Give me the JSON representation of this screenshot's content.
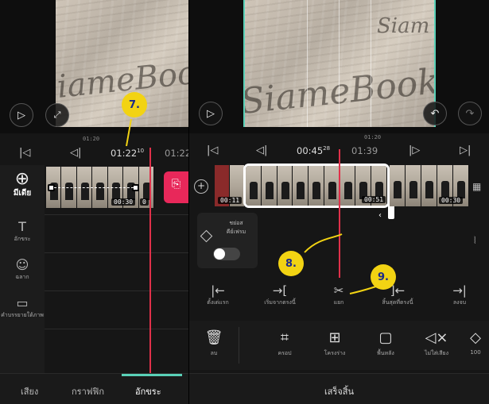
{
  "left_panel": {
    "ruler": {
      "label": "01:20"
    },
    "transport": {
      "time_main": "01:22",
      "time_sup": "10",
      "time_next": "01:22"
    },
    "sidebar": [
      {
        "icon": "plus-circle-icon",
        "label": "มีเดีย"
      },
      {
        "icon": "text-icon",
        "label": "อักขระ"
      },
      {
        "icon": "sticker-icon",
        "label": "ฉลาก"
      },
      {
        "icon": "subtitle-icon",
        "label": "คำบรรยายใต้ภาพ"
      }
    ],
    "clip": {
      "duration": "00:30",
      "count": "0"
    },
    "bottom_nav": {
      "tab_audio": "เสียง",
      "tab_graphic": "กราฟฟิก",
      "tab_text": "อักขระ"
    }
  },
  "right_panel": {
    "ruler": {
      "label": "01:20"
    },
    "transport": {
      "time_main": "00:45",
      "time_sup": "28",
      "time_next": "01:39"
    },
    "clip_durations": {
      "start": "00:11",
      "selected": "00:51",
      "end": "00:30"
    },
    "keyframe_panel": {
      "title": "ชย่อส\nคีย์เฟรม"
    },
    "toolbar_top": [
      {
        "icon": "trim-left-icon",
        "label": "ตั้งเด่แรก"
      },
      {
        "icon": "split-left-icon",
        "label": "เริ่มจากตรงนี้"
      },
      {
        "icon": "scissors-icon",
        "label": "แยก"
      },
      {
        "icon": "split-right-icon",
        "label": "สิ้นสุดที่ตรงนี้"
      },
      {
        "icon": "trim-right-icon",
        "label": "ลงจบ"
      }
    ],
    "toolbar_bottom": [
      {
        "icon": "trash-icon",
        "label": "ลบ"
      },
      {
        "icon": "crop-icon",
        "label": "ครอป"
      },
      {
        "icon": "layout-icon",
        "label": "โครงร่าง"
      },
      {
        "icon": "background-icon",
        "label": "พื้นหลัง"
      },
      {
        "icon": "volume-icon",
        "label": "ไม่ใส่เสียง"
      },
      {
        "icon": "speed-icon",
        "label": "100"
      }
    ],
    "finish_label": "เสร็จสิ้น"
  },
  "annotations": {
    "step7": "7.",
    "step8": "8.",
    "step9": "9."
  },
  "watermark": {
    "main": "SiameBook",
    "alt": "Siam"
  },
  "colors": {
    "playhead": "#e0304a",
    "accent": "#5ad1b8",
    "badge": "#f2d313",
    "selection": "#ffffff"
  }
}
